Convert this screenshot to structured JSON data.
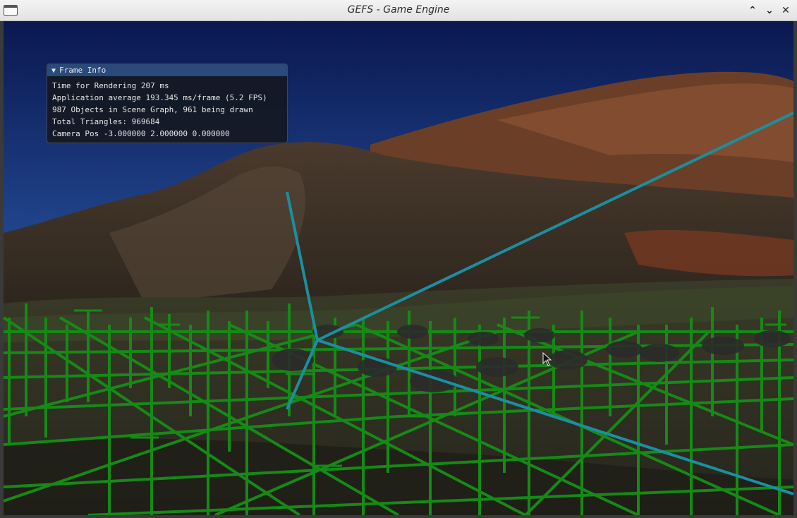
{
  "window": {
    "title": "GEFS - Game Engine",
    "controls": {
      "minimize_icon": "chevron-up-icon",
      "restore_icon": "chevron-down-icon",
      "close_icon": "close-icon",
      "minimize_glyph": "⌃",
      "restore_glyph": "⌄",
      "close_glyph": "✕"
    }
  },
  "frame_info": {
    "title": "Frame Info",
    "collapse_glyph": "▼",
    "lines": [
      "Time for Rendering 207 ms",
      "Application average 193.345 ms/frame (5.2 FPS)",
      "987 Objects in Scene Graph, 961 being drawn",
      "Total Triangles: 969684",
      "Camera Pos -3.000000 2.000000 0.000000"
    ]
  },
  "scene": {
    "colors": {
      "sky_top": "#0b1a52",
      "sky_bottom": "#3f6fb6",
      "mountain": "#3b2f25",
      "rust": "#8a4a2a",
      "ground": "#2a2a20",
      "grid": "#1a8a1a",
      "axis": "#1e8a9a"
    }
  }
}
